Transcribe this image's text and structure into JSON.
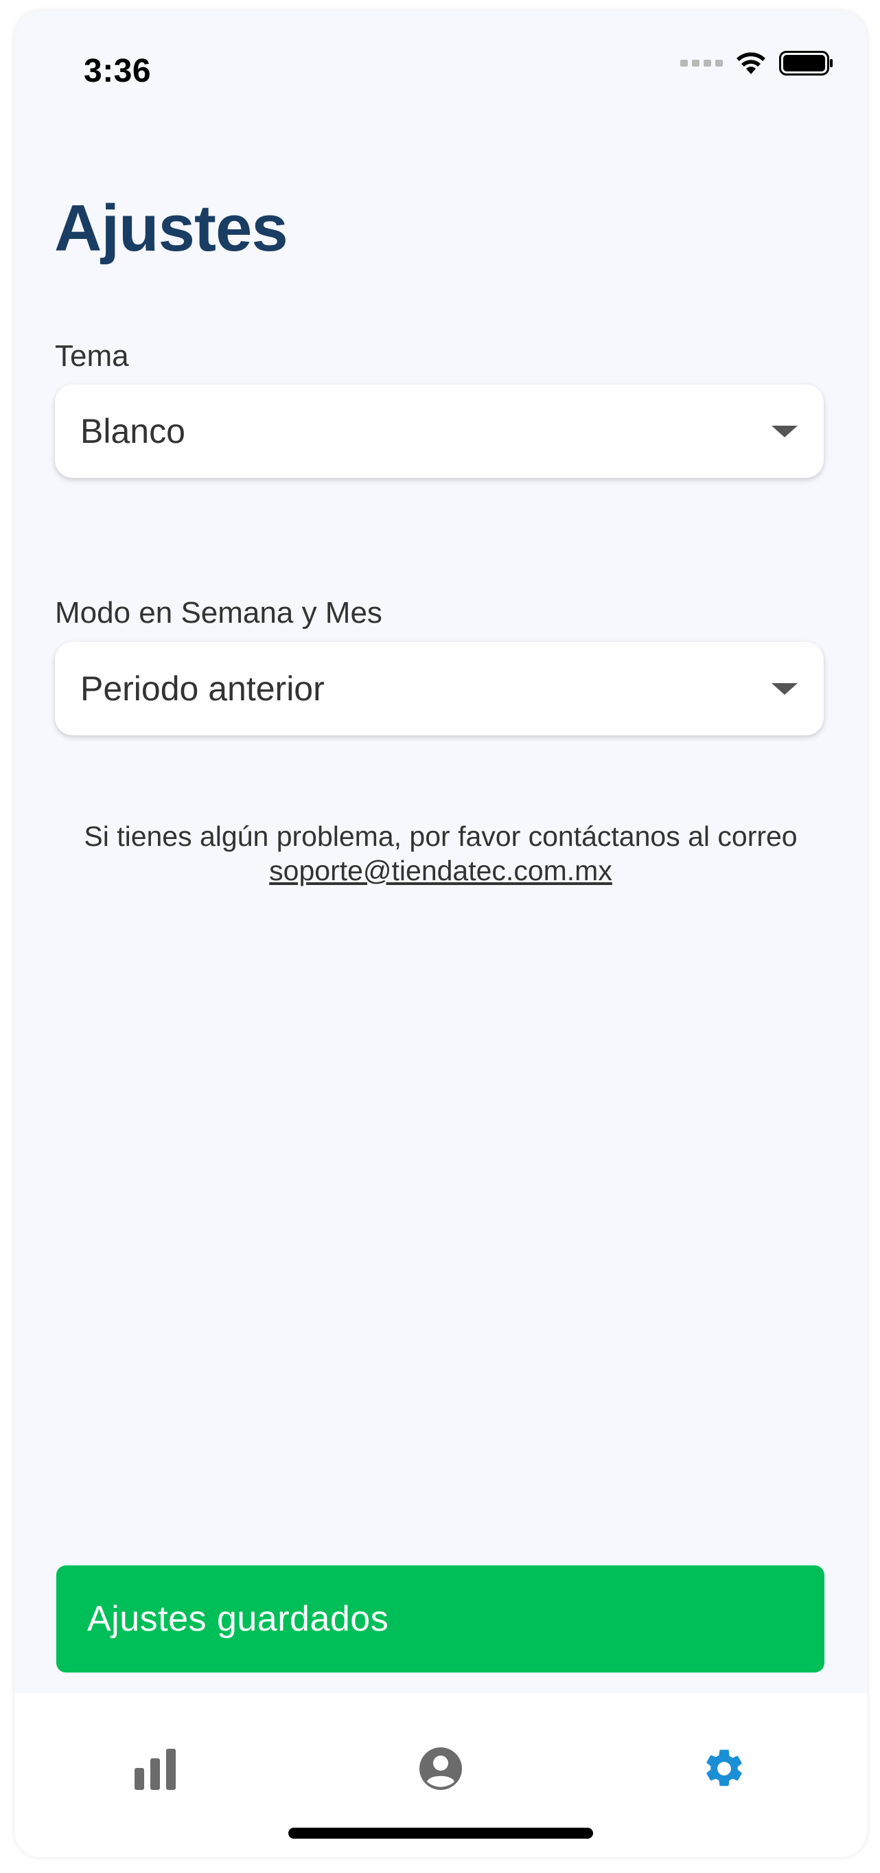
{
  "status_bar": {
    "time": "3:36"
  },
  "page": {
    "title": "Ajustes"
  },
  "settings": {
    "theme": {
      "label": "Tema",
      "value": "Blanco"
    },
    "mode": {
      "label": "Modo en Semana y Mes",
      "value": "Periodo anterior"
    }
  },
  "support": {
    "text": "Si tienes algún problema, por favor contáctanos al correo",
    "email": "soporte@tiendatec.com.mx"
  },
  "toast": {
    "message": "Ajustes guardados"
  },
  "tabbar": {
    "items": [
      {
        "icon": "bar-chart-icon",
        "active": false
      },
      {
        "icon": "user-circle-icon",
        "active": false
      },
      {
        "icon": "gear-icon",
        "active": true
      }
    ],
    "active_color": "#1a8fd6",
    "inactive_color": "#6b6b6b"
  },
  "colors": {
    "title": "#1a3d63",
    "toast_bg": "#00bf58",
    "background": "#f6f8fe"
  }
}
